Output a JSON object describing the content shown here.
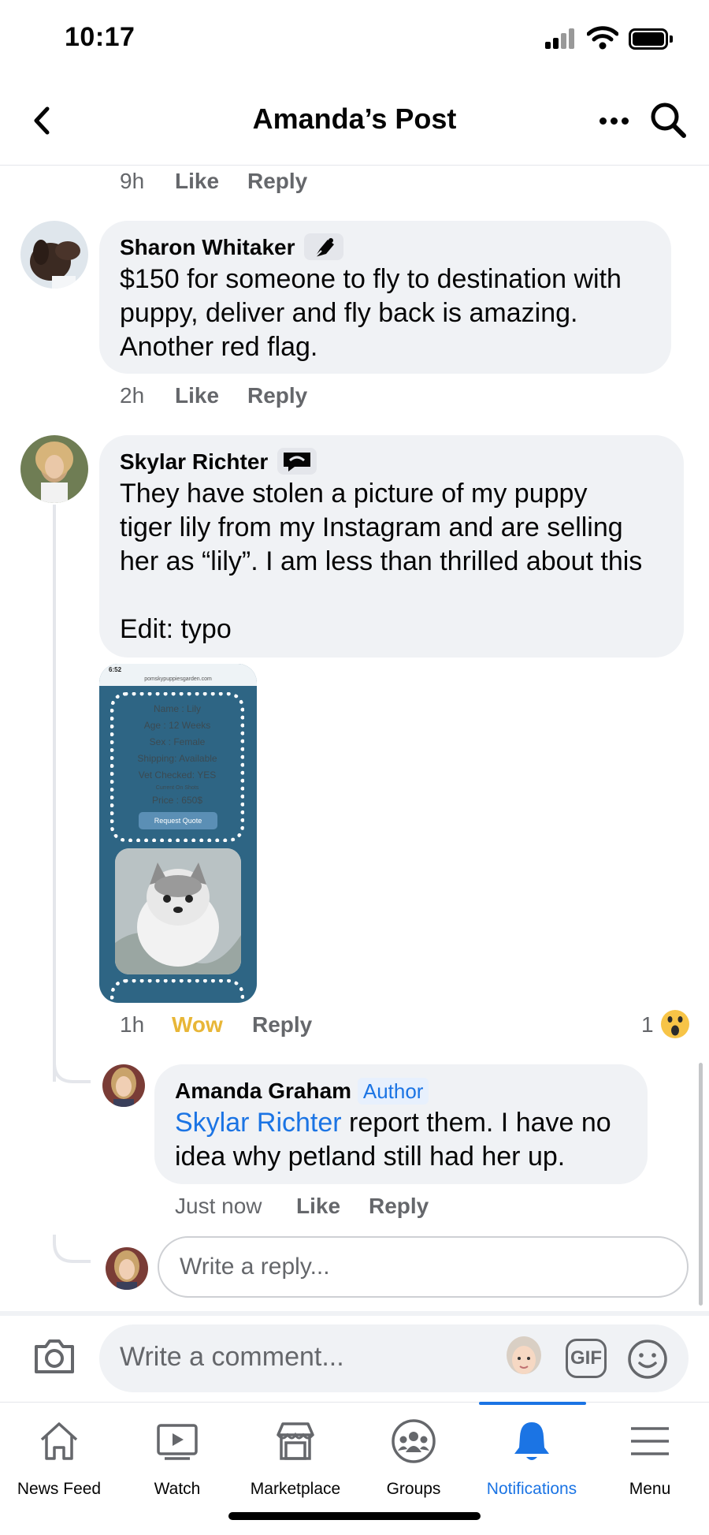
{
  "status_bar": {
    "time": "10:17"
  },
  "header": {
    "title": "Amanda’s Post"
  },
  "top_comment_meta": {
    "time": "9h",
    "like": "Like",
    "reply": "Reply"
  },
  "comments": [
    {
      "author": "Sharon Whitaker",
      "badge": "pen-icon",
      "text_lines": [
        "$150 for someone to fly to destination with",
        "puppy, deliver and fly back is amazing.",
        "Another red flag."
      ],
      "time": "2h",
      "like": "Like",
      "reply": "Reply"
    },
    {
      "author": "Skylar Richter",
      "badge": "chat-icon",
      "text_lines": [
        "They have stolen a picture of my puppy",
        "tiger lily from my Instagram and are selling",
        "her as “lily”. I am less than thrilled about this",
        "",
        "Edit: typo"
      ],
      "time": "1h",
      "reaction_label": "Wow",
      "reply": "Reply",
      "reaction_count": "1",
      "attachment": {
        "status_time": "6:52",
        "url": "pomskypuppiesgarden.com",
        "spec_lines": [
          "Name : Lily",
          "Age : 12 Weeks",
          "Sex : Female",
          "Shipping: Available",
          "Vet Checked: YES"
        ],
        "small_line": "Current On Shots",
        "price": "Price : 650$",
        "button": "Request Quote"
      }
    }
  ],
  "reply": {
    "author": "Amanda Graham",
    "tag": "Author",
    "mention": "Skylar Richter",
    "text_first": " report them. I have no",
    "text_second": "idea why petland still had her up.",
    "time": "Just now",
    "like": "Like",
    "reply": "Reply"
  },
  "reply_input": {
    "placeholder": "Write a reply..."
  },
  "composer": {
    "placeholder": "Write a comment...",
    "gif": "GIF"
  },
  "tabs": [
    {
      "label": "News Feed",
      "icon": "home-icon"
    },
    {
      "label": "Watch",
      "icon": "watch-icon"
    },
    {
      "label": "Marketplace",
      "icon": "marketplace-icon"
    },
    {
      "label": "Groups",
      "icon": "groups-icon"
    },
    {
      "label": "Notifications",
      "icon": "bell-icon",
      "active": true
    },
    {
      "label": "Menu",
      "icon": "menu-icon"
    }
  ],
  "colors": {
    "accent": "#1b74e4",
    "wow": "#e8b637",
    "bubble": "#f0f2f5",
    "secondary_text": "#65676b"
  }
}
